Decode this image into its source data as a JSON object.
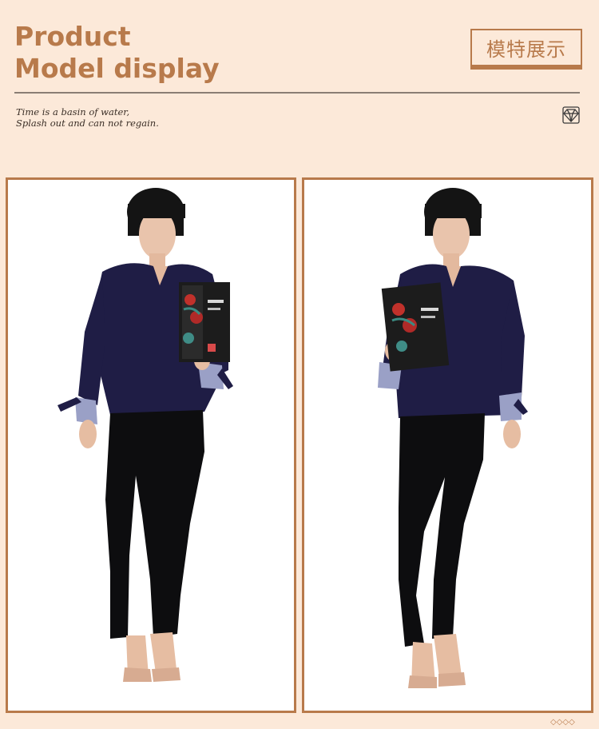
{
  "header": {
    "title_line1": "Product",
    "title_line2": "Model display",
    "badge_label": "模特展示",
    "quote_line1": "Time is a basin of water,",
    "quote_line2": "Splash out and can not regain."
  },
  "icons": {
    "gem": "diamond-outline-icon",
    "footer": "diamond-dots-icon"
  },
  "footer": {
    "dots": "◇◇◇◇"
  },
  "colors": {
    "background": "#fce9d9",
    "accent": "#b87a4b",
    "divider": "#8a7e74",
    "sweater": "#1f1d45",
    "leggings": "#0d0d0f"
  }
}
